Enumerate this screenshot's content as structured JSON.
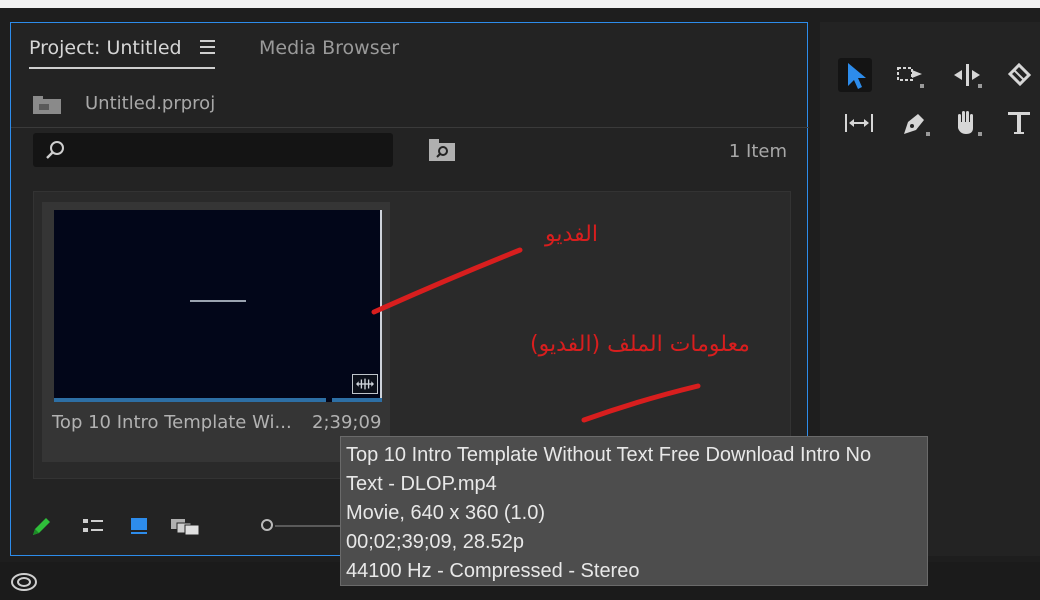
{
  "project_panel": {
    "tabs": [
      {
        "label": "Project: Untitled",
        "active": true
      },
      {
        "label": "Media Browser",
        "active": false
      }
    ],
    "file_name": "Untitled.prproj",
    "search": {
      "value": "",
      "placeholder": ""
    },
    "item_count": "1 Item",
    "clip": {
      "name": "Top 10 Intro Template Wi...",
      "duration": "2;39;09"
    }
  },
  "tooltip": {
    "lines": [
      "Top 10 Intro Template Without Text Free Download Intro No",
      "Text - DLOP.mp4",
      "Movie, 640 x 360 (1.0)",
      "00;02;39;09, 28.52p",
      "44100 Hz - Compressed - Stereo"
    ]
  },
  "annotations": {
    "label_video": "الفديو",
    "label_file_info": "معلومات الملف (الفديو)",
    "color": "#d81e1e"
  },
  "tools": [
    "selection-tool",
    "track-select-tool",
    "ripple-edit-tool",
    "razor-tool",
    "slip-tool",
    "pen-tool",
    "hand-tool",
    "type-tool"
  ],
  "colors": {
    "panel_border": "#2d8ceb",
    "selection_accent": "#2d8ceb",
    "pencil_green": "#2fbf3a"
  }
}
